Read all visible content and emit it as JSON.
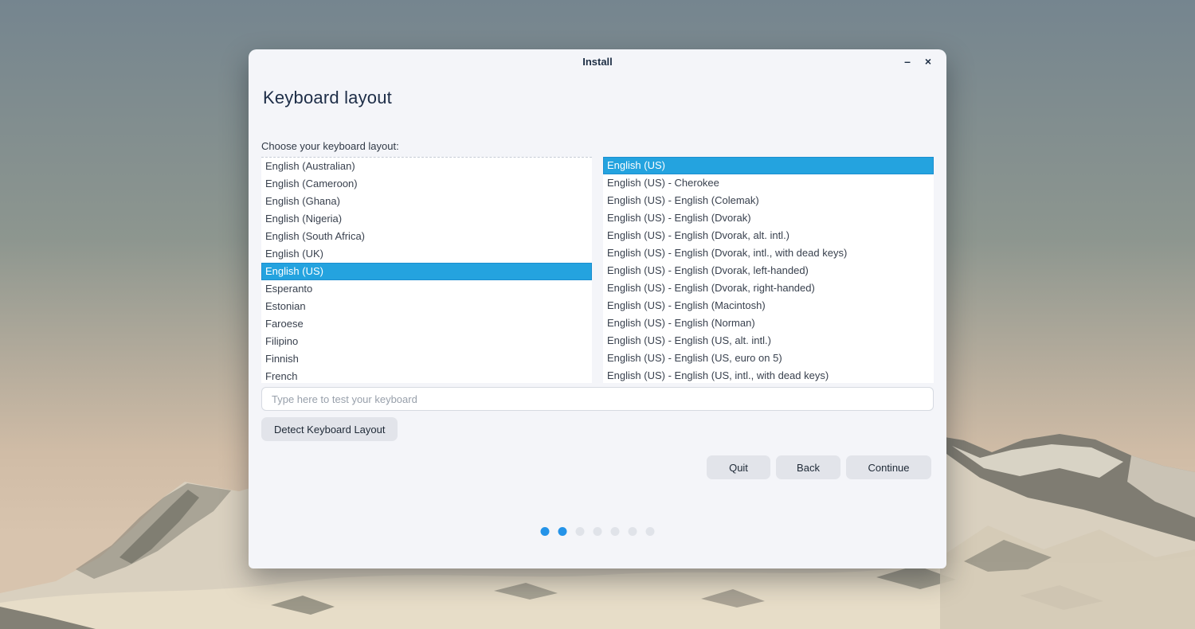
{
  "window": {
    "title": "Install",
    "controls": {
      "minimize": "–",
      "close": "×"
    },
    "heading": "Keyboard layout",
    "instruction": "Choose your keyboard layout:",
    "layout_list": {
      "selected_index": 6,
      "items": [
        "English (Australian)",
        "English (Cameroon)",
        "English (Ghana)",
        "English (Nigeria)",
        "English (South Africa)",
        "English (UK)",
        "English (US)",
        "Esperanto",
        "Estonian",
        "Faroese",
        "Filipino",
        "Finnish",
        "French"
      ]
    },
    "variant_list": {
      "selected_index": 0,
      "items": [
        "English (US)",
        "English (US) - Cherokee",
        "English (US) - English (Colemak)",
        "English (US) - English (Dvorak)",
        "English (US) - English (Dvorak, alt. intl.)",
        "English (US) - English (Dvorak, intl., with dead keys)",
        "English (US) - English (Dvorak, left-handed)",
        "English (US) - English (Dvorak, right-handed)",
        "English (US) - English (Macintosh)",
        "English (US) - English (Norman)",
        "English (US) - English (US, alt. intl.)",
        "English (US) - English (US, euro on 5)",
        "English (US) - English (US, intl., with dead keys)"
      ]
    },
    "test_input": {
      "placeholder": "Type here to test your keyboard",
      "value": ""
    },
    "detect_button": "Detect Keyboard Layout",
    "nav_buttons": {
      "quit": "Quit",
      "back": "Back",
      "continue": "Continue"
    },
    "progress": {
      "total": 7,
      "current": 2
    }
  },
  "colors": {
    "dialog_bg": "#f4f5f9",
    "highlight": "#24a3df",
    "highlight_border": "#1b8fd0",
    "dot_active": "#2493e8",
    "dot_inactive": "#e0e3e9"
  }
}
